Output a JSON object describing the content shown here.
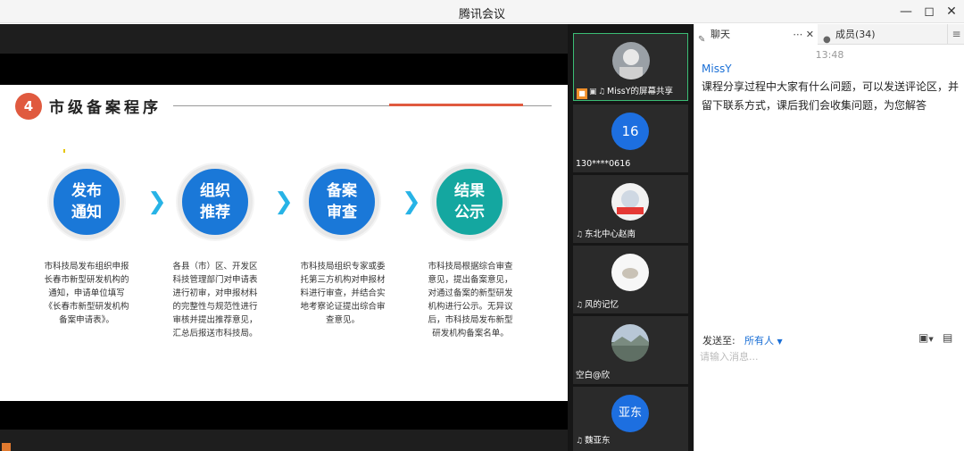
{
  "window": {
    "title": "腾讯会议"
  },
  "slide": {
    "number": "4",
    "title": "市级备案程序",
    "steps": [
      {
        "label": "发布通知",
        "desc": "市科技局发布组织申报长春市新型研发机构的通知，申请单位填写《长春市新型研发机构备案申请表》。"
      },
      {
        "label": "组织推荐",
        "desc": "各县（市）区、开发区科技管理部门对申请表进行初审，对申报材料的完整性与规范性进行审核并提出推荐意见，汇总后报送市科技局。"
      },
      {
        "label": "备案审查",
        "desc": "市科技局组织专家或委托第三方机构对申报材料进行审查，并结合实地考察论证提出综合审查意见。"
      },
      {
        "label": "结果公示",
        "desc": "市科技局根据综合审查意见，提出备案意见，对通过备案的新型研发机构进行公示。无异议后，市科技局发布新型研发机构备案名单。"
      }
    ]
  },
  "participants": [
    {
      "name": "MissY的屏幕共享",
      "avatar": "photo"
    },
    {
      "name": "130****0616",
      "avatar": "16"
    },
    {
      "name": "东北中心赵南",
      "avatar": "photo"
    },
    {
      "name": "风的记忆",
      "avatar": "photo"
    },
    {
      "name": "空白@欣",
      "avatar": "photo"
    },
    {
      "name": "魏亚东",
      "avatar": "亚东"
    }
  ],
  "chat": {
    "tab_chat": "聊天",
    "tab_members": "成员(34)",
    "time": "13:48",
    "sender": "MissY",
    "message": "课程分享过程中大家有什么问题，可以发送评论区，并留下联系方式，课后我们会收集问题，为您解答",
    "send_to_label": "发送至:",
    "send_to_value": "所有人",
    "input_placeholder": "请输入消息..."
  },
  "icons": {
    "minimize": "minimize-icon",
    "maximize": "maximize-icon",
    "close": "close-icon",
    "chevron": "chevron-right-icon",
    "mic": "mic-icon",
    "chat_tab": "chat-icon",
    "members_tab": "members-icon"
  }
}
